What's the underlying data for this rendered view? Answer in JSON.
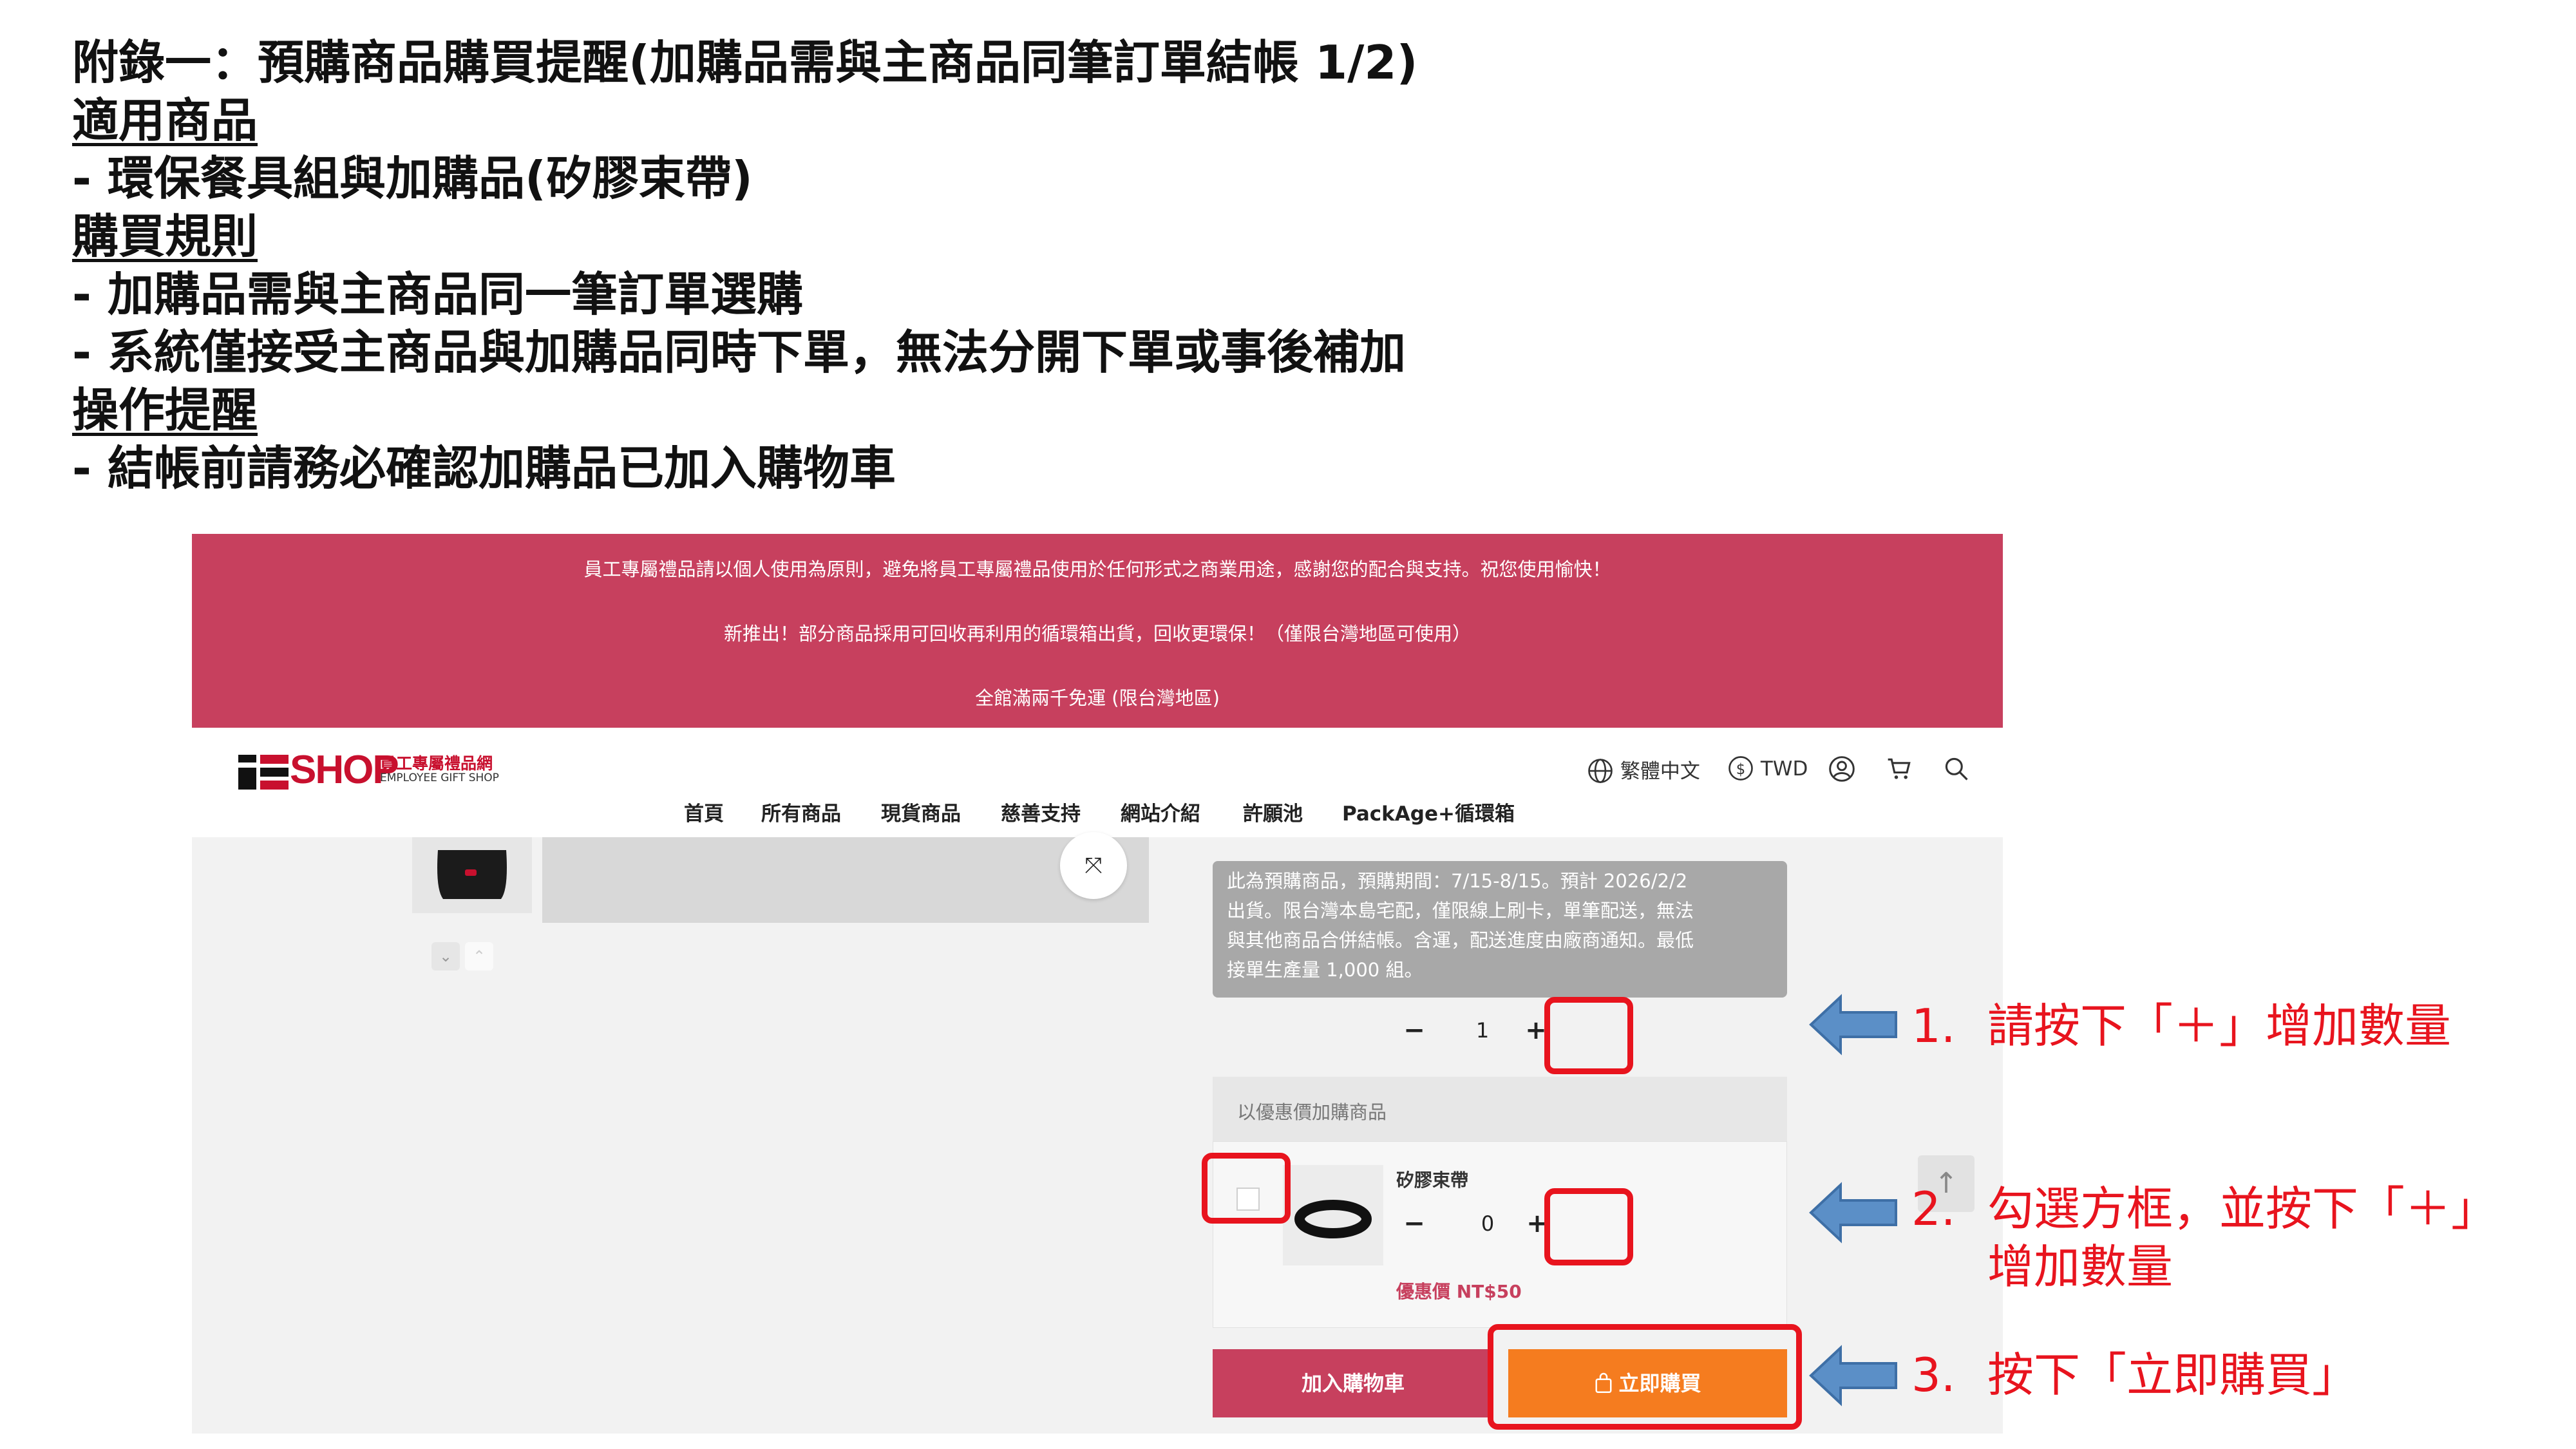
{
  "doc": {
    "title": "附錄一：預購商品購買提醒(加購品需與主商品同筆訂單結帳 1/2)",
    "section1_heading": "適用商品",
    "section1_item1": " - 環保餐具組與加購品(矽膠束帶)",
    "section2_heading": "購買規則",
    "section2_item1": " - 加購品需與主商品同一筆訂單選購",
    "section2_item2": " - 系統僅接受主商品與加購品同時下單，無法分開下單或事後補加",
    "section3_heading": "操作提醒",
    "section3_item1": "- 結帳前請務必確認加購品已加入購物車"
  },
  "shop": {
    "announcement": {
      "line1": "員工專屬禮品請以個人使用為原則，避免將員工專屬禮品使用於任何形式之商業用途，感謝您的配合與支持。祝您使用愉快！",
      "line2": "新推出！部分商品採用可回收再利用的循環箱出貨，回收更環保！（僅限台灣地區可使用）",
      "line3": "全館滿兩千免運 (限台灣地區)"
    },
    "logo": {
      "shop": "SHOP",
      "name_cn": "員工專屬禮品網",
      "name_en": "EMPLOYEE GIFT SHOP"
    },
    "header": {
      "language": "繁體中文",
      "currency": "TWD"
    },
    "nav": [
      "首頁",
      "所有商品",
      "現貨商品",
      "慈善支持",
      "網站介紹",
      "許願池",
      "PackAge+循環箱"
    ],
    "product": {
      "notice_lines": [
        "此為預購商品，預購期間：7/15-8/15。預計 2026/2/2",
        "出貨。限台灣本島宅配，僅限線上刷卡，單筆配送，無法",
        "與其他商品合併結帳。含運，配送進度由廠商通知。最低",
        "接單生產量 1,000 組。"
      ],
      "qty_minus": "−",
      "qty_value": "1",
      "qty_plus": "+"
    },
    "addon": {
      "header": "以優惠價加購商品",
      "name": "矽膠束帶",
      "qty_minus": "−",
      "qty_value": "0",
      "qty_plus": "+",
      "price": "優惠價 NT$50"
    },
    "buttons": {
      "add_to_cart": "加入購物車",
      "buy_now": "立即購買"
    }
  },
  "steps": [
    {
      "number": "1.",
      "text": "請按下「＋」增加數量"
    },
    {
      "number": "2.",
      "text": "勾選方框，並按下「＋」",
      "text2": "增加數量"
    },
    {
      "number": "3.",
      "text": "按下「立即購買」"
    }
  ],
  "colors": {
    "announcement_bg": "#c7405e",
    "brand_red": "#c8102e",
    "buy_now": "#f57c1f",
    "annotation_red": "#e8141e",
    "arrow_blue": "#5b8fc7"
  }
}
